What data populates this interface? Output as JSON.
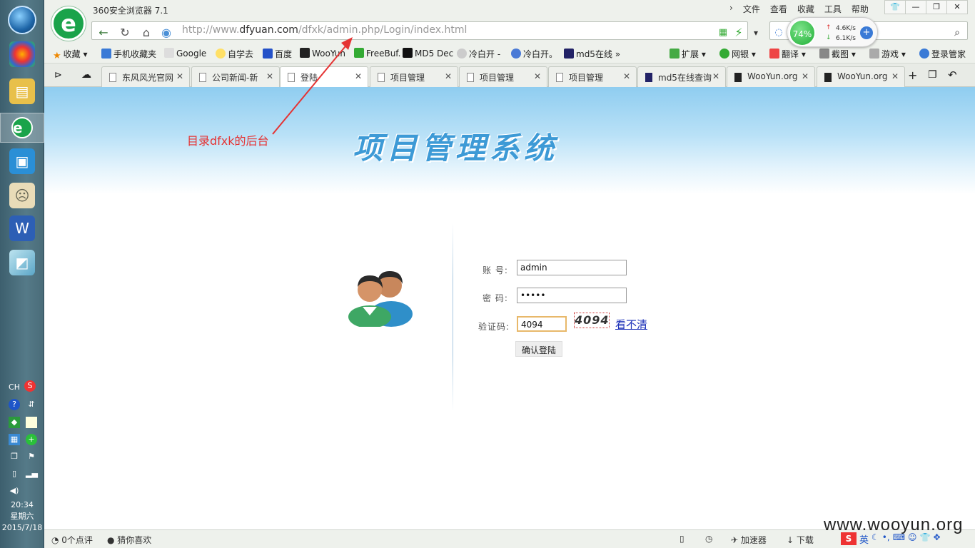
{
  "taskbar": {
    "tray": {
      "lang": "CH",
      "time": "20:34",
      "weekday": "星期六",
      "date": "2015/7/18"
    }
  },
  "browser": {
    "title": "360安全浏览器 7.1",
    "menu": [
      "文件",
      "查看",
      "收藏",
      "工具",
      "帮助"
    ],
    "address": {
      "prefix": "http://www.",
      "domain": "dfyuan.com",
      "path": "/dfxk/admin.php/Login/index.html"
    },
    "speed": {
      "percent": "74%",
      "up": "4.6K/s",
      "down": "6.1K/s"
    },
    "bookmarks": [
      "收藏",
      "手机收藏夹",
      "Google",
      "自学去",
      "百度",
      "WooYun",
      "FreeBuf.",
      "MD5 Dec",
      "冷白开 -",
      "冷白开。",
      "md5在线",
      "扩展",
      "网银",
      "翻译",
      "截图",
      "游戏",
      "登录管家"
    ],
    "tabs": [
      "东风风光官网",
      "公司新闻-新",
      "登陆",
      "项目管理",
      "项目管理",
      "项目管理",
      "md5在线查询",
      "WooYun.org",
      "WooYun.org"
    ],
    "active_tab": 2,
    "status": {
      "comments": "0个点评",
      "guess": "猜你喜欢",
      "accel": "加速器",
      "download": "下载"
    }
  },
  "page": {
    "banner_title": "项目管理系统",
    "annotation": "目录dfxk的后台",
    "form": {
      "username_label": "账  号:",
      "username_value": "admin",
      "password_label": "密  码:",
      "password_value": "•••••",
      "captcha_label": "验证码:",
      "captcha_value": "4094",
      "captcha_image_text": "4094",
      "captcha_refresh": "看不清",
      "submit": "确认登陆"
    }
  },
  "watermark": "www.wooyun.org",
  "colors": {
    "annotation": "#e53333",
    "banner_title": "#3d9ad6",
    "link": "#1a2fb8",
    "browser_green": "#1aa34a"
  }
}
